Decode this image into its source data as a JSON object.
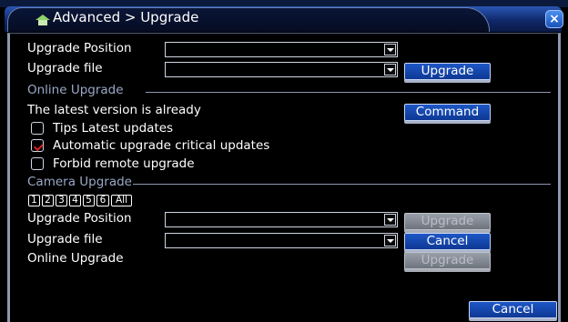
{
  "window": {
    "title": "Advanced > Upgrade",
    "close_glyph": "×",
    "title_icon": "house-icon"
  },
  "upgrade": {
    "position_label": "Upgrade Position",
    "position_value": "",
    "file_label": "Upgrade file",
    "file_value": "",
    "upgrade_button": "Upgrade"
  },
  "online": {
    "section_title": "Online Upgrade",
    "status_text": "The latest version is already",
    "command_button": "Command",
    "options": [
      {
        "label": "Tips Latest updates",
        "checked": false
      },
      {
        "label": "Automatic upgrade critical updates",
        "checked": true
      },
      {
        "label": "Forbid remote upgrade",
        "checked": false
      }
    ]
  },
  "camera": {
    "section_title": "Camera Upgrade",
    "channels": [
      "1",
      "2",
      "3",
      "4",
      "5",
      "6",
      "All"
    ],
    "position_label": "Upgrade Position",
    "position_value": "",
    "position_button": "Upgrade",
    "file_label": "Upgrade file",
    "file_value": "",
    "file_button": "Cancel",
    "online_label": "Online Upgrade",
    "online_button": "Upgrade"
  },
  "footer": {
    "cancel_button": "Cancel"
  }
}
